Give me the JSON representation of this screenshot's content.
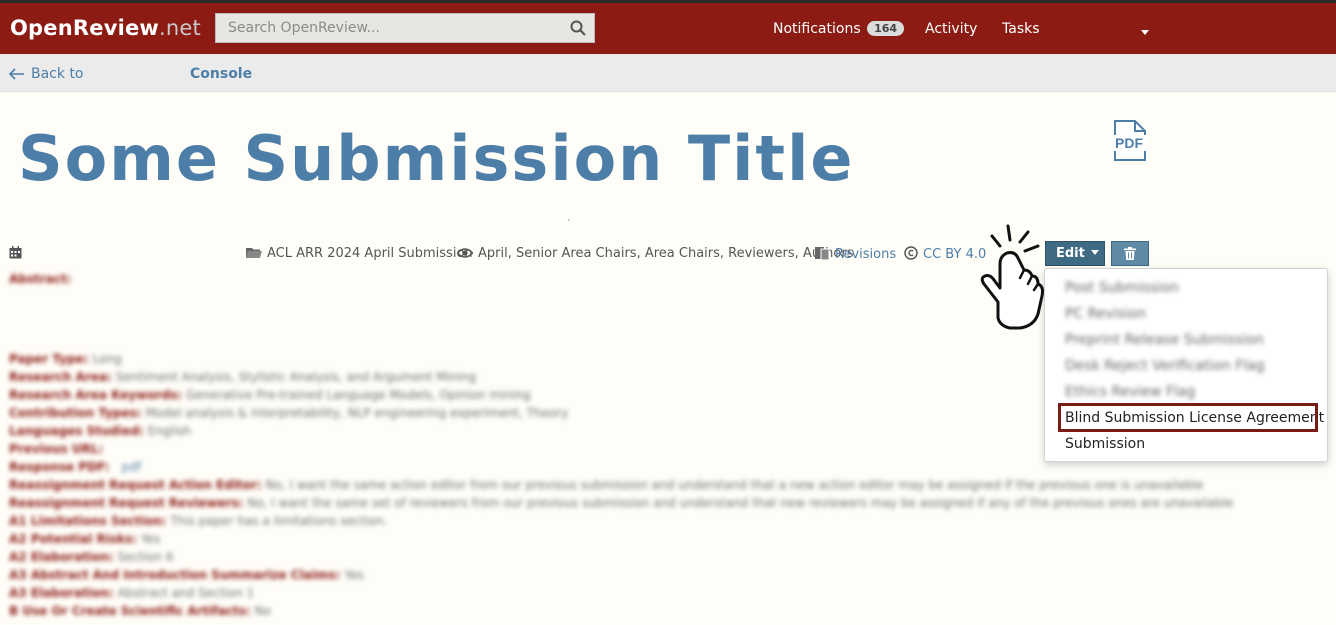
{
  "header": {
    "brand_main": "OpenReview",
    "brand_suffix": ".net",
    "search_placeholder": "Search OpenReview...",
    "notifications_label": "Notifications",
    "notifications_count": "164",
    "activity_label": "Activity",
    "tasks_label": "Tasks"
  },
  "subnav": {
    "back_label": "Back to",
    "console_label": "Console"
  },
  "paper": {
    "title": "Some Submission Title",
    "venue": "ACL ARR 2024 April Submission",
    "readers": "April, Senior Area Chairs, Area Chairs, Reviewers, Authors",
    "revisions_label": "Revisions",
    "license": "CC BY 4.0"
  },
  "actions": {
    "edit_label": "Edit",
    "edit_menu": [
      "Post Submission",
      "PC Revision",
      "Preprint Release Submission",
      "Desk Reject Verification Flag",
      "Ethics Review Flag",
      "Blind Submission License Agreement",
      "Submission"
    ]
  },
  "fields": [
    {
      "k": "Abstract:",
      "v": ""
    },
    {
      "k": "Paper Type:",
      "v": "Long"
    },
    {
      "k": "Research Area:",
      "v": "Sentiment Analysis, Stylistic Analysis, and Argument Mining"
    },
    {
      "k": "Research Area Keywords:",
      "v": "Generative Pre-trained Language Models, Opinion mining"
    },
    {
      "k": "Contribution Types:",
      "v": "Model analysis & interpretability, NLP engineering experiment, Theory"
    },
    {
      "k": "Languages Studied:",
      "v": "English"
    },
    {
      "k": "Previous URL:",
      "v": ""
    },
    {
      "k": "Response PDF:",
      "v": "pdf"
    },
    {
      "k": "Reassignment Request Action Editor:",
      "v": "No, I want the same action editor from our previous submission and understand that a new action editor may be assigned if the previous one is unavailable"
    },
    {
      "k": "Reassignment Request Reviewers:",
      "v": "No, I want the same set of reviewers from our previous submission and understand that new reviewers may be assigned if any of the previous ones are unavailable"
    },
    {
      "k": "A1 Limitations Section:",
      "v": "This paper has a limitations section."
    },
    {
      "k": "A2 Potential Risks:",
      "v": "Yes"
    },
    {
      "k": "A2 Elaboration:",
      "v": "Section 6"
    },
    {
      "k": "A3 Abstract And Introduction Summarize Claims:",
      "v": "Yes"
    },
    {
      "k": "A3 Elaboration:",
      "v": "Abstract and Section 1"
    },
    {
      "k": "B Use Or Create Scientific Artifacts:",
      "v": "No"
    }
  ]
}
